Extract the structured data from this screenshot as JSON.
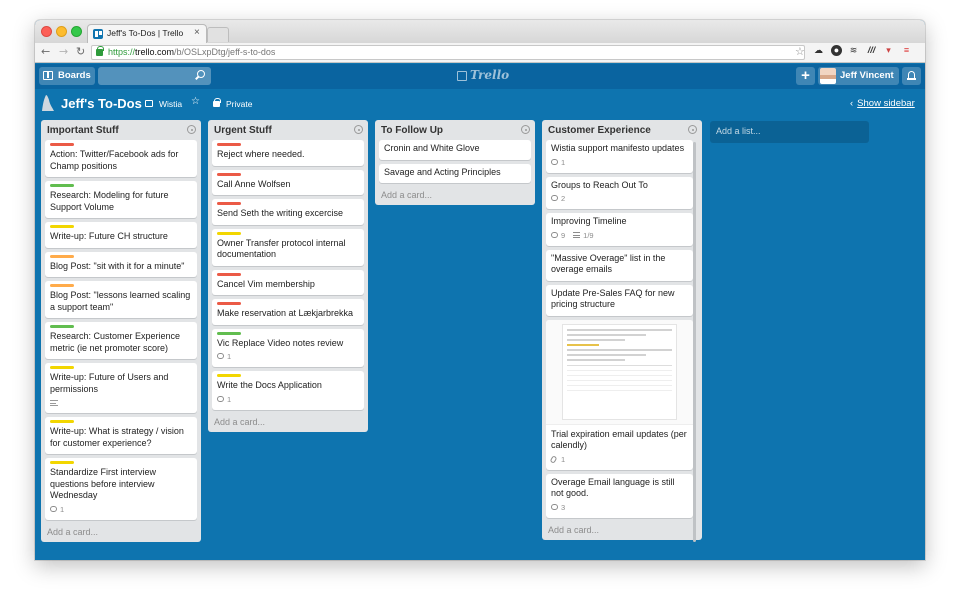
{
  "browser": {
    "tab_title": "Jeff's To-Dos | Trello",
    "url_protocol": "https://",
    "url_host": "trello.com",
    "url_path": "/b/OSLxpDtg/jeff-s-to-dos"
  },
  "header": {
    "boards_label": "Boards",
    "search_placeholder": "",
    "logo_text": "Trello",
    "member_name": "Jeff Vincent",
    "plus_label": "+"
  },
  "board": {
    "title": "Jeff's To-Dos",
    "team": "Wistia",
    "privacy": "Private",
    "show_sidebar": "Show sidebar",
    "add_list": "Add a list..."
  },
  "colors": {
    "board_bg": "#0e74af",
    "header_bg": "#0a64a0",
    "label_red": "#eb5a46",
    "label_green": "#61bd4f",
    "label_yellow": "#f2d600",
    "label_orange": "#ffab4a"
  },
  "lists": [
    {
      "title": "Important Stuff",
      "add_card": "Add a card...",
      "cards": [
        {
          "title": "Action: Twitter/Facebook ads for Champ positions",
          "label": "red"
        },
        {
          "title": "Research: Modeling for future Support Volume",
          "label": "green"
        },
        {
          "title": "Write-up: Future CH structure",
          "label": "yellow"
        },
        {
          "title": "Blog Post: \"sit with it for a minute\"",
          "label": "orange"
        },
        {
          "title": "Blog Post: \"lessons learned scaling a support team\"",
          "label": "orange"
        },
        {
          "title": "Research: Customer Experience metric (ie net promoter score)",
          "label": "green"
        },
        {
          "title": "Write-up: Future of Users and permissions",
          "label": "yellow",
          "description": true
        },
        {
          "title": "Write-up: What is strategy / vision for customer experience?",
          "label": "yellow"
        },
        {
          "title": "Standardize First interview questions before interview Wednesday",
          "label": "yellow",
          "comments": "1"
        }
      ]
    },
    {
      "title": "Urgent Stuff",
      "add_card": "Add a card...",
      "cards": [
        {
          "title": "Reject where needed.",
          "label": "red"
        },
        {
          "title": "Call Anne Wolfsen",
          "label": "red"
        },
        {
          "title": "Send Seth the writing excercise",
          "label": "red"
        },
        {
          "title": "Owner Transfer protocol internal documentation",
          "label": "yellow"
        },
        {
          "title": "Cancel Vim membership",
          "label": "red"
        },
        {
          "title": "Make reservation at Lækjarbrekka",
          "label": "red"
        },
        {
          "title": "Vic Replace Video notes review",
          "label": "green",
          "comments": "1"
        },
        {
          "title": "Write the Docs Application",
          "label": "yellow",
          "comments": "1"
        }
      ]
    },
    {
      "title": "To Follow Up",
      "add_card": "Add a card...",
      "cards": [
        {
          "title": "Cronin and White Glove"
        },
        {
          "title": "Savage and Acting Principles"
        }
      ]
    },
    {
      "title": "Customer Experience",
      "add_card": "Add a card...",
      "cards": [
        {
          "title": "Wistia support manifesto updates",
          "comments": "1"
        },
        {
          "title": "Groups to Reach Out To",
          "comments": "2"
        },
        {
          "title": "Improving Timeline",
          "comments": "9",
          "checklist": "1/9"
        },
        {
          "title": "\"Massive Overage\" list in the overage emails"
        },
        {
          "title": "Update Pre-Sales FAQ for new pricing structure"
        },
        {
          "title": "Trial expiration email updates (per calendly)",
          "attachments": "1",
          "cover": true
        },
        {
          "title": "Overage Email language is still not good.",
          "comments": "3"
        }
      ]
    }
  ]
}
